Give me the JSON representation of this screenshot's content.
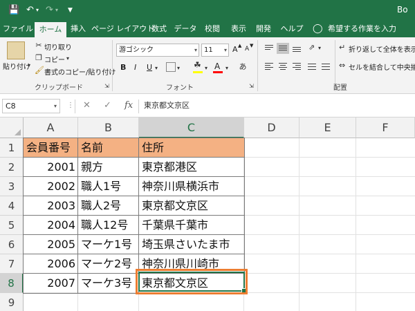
{
  "titlebar": {
    "app_title": "Bo",
    "save_icon": "save-icon",
    "undo_icon": "undo-icon",
    "redo_icon": "redo-icon",
    "customize_icon": "customize-icon"
  },
  "tabs": [
    {
      "label": "ファイル"
    },
    {
      "label": "ホーム"
    },
    {
      "label": "挿入"
    },
    {
      "label": "ページ レイアウト"
    },
    {
      "label": "数式"
    },
    {
      "label": "データ"
    },
    {
      "label": "校閲"
    },
    {
      "label": "表示"
    },
    {
      "label": "開発"
    },
    {
      "label": "ヘルプ"
    },
    {
      "label": "希望する作業を入力"
    }
  ],
  "ribbon": {
    "clipboard": {
      "paste": "貼り付け",
      "cut": "切り取り",
      "copy": "コピー",
      "format_painter": "書式のコピー/貼り付け",
      "label": "クリップボード"
    },
    "font": {
      "name": "游ゴシック",
      "size": "11",
      "grow": "A",
      "shrink": "A",
      "bold": "B",
      "italic": "I",
      "underline": "U",
      "color_a": "A",
      "label": "フォント"
    },
    "alignment": {
      "wrap_text": "折り返して全体を表示す",
      "merge_center": "セルを結合して中央揃え",
      "label": "配置"
    }
  },
  "formula_bar": {
    "name_box": "C8",
    "fx": "fx",
    "content": "東京都文京区"
  },
  "sheet": {
    "columns": [
      "A",
      "B",
      "C",
      "D",
      "E",
      "F"
    ],
    "rows": [
      "1",
      "2",
      "3",
      "4",
      "5",
      "6",
      "7",
      "8",
      "9"
    ],
    "active_cell": "C8",
    "header_fill": "#f4b183",
    "table": {
      "headers": [
        "会員番号",
        "名前",
        "住所"
      ],
      "rows": [
        [
          "2001",
          "親方",
          "東京都港区"
        ],
        [
          "2002",
          "職人1号",
          "神奈川県横浜市"
        ],
        [
          "2003",
          "職人2号",
          "東京都文京区"
        ],
        [
          "2004",
          "職人12号",
          "千葉県千葉市"
        ],
        [
          "2005",
          "マーケ1号",
          "埼玉県さいたま市"
        ],
        [
          "2006",
          "マーケ2号",
          "神奈川県川崎市"
        ],
        [
          "2007",
          "マーケ3号",
          "東京都文京区"
        ]
      ]
    }
  },
  "colors": {
    "excel_green": "#217346",
    "highlight_orange": "#ed7d31"
  }
}
